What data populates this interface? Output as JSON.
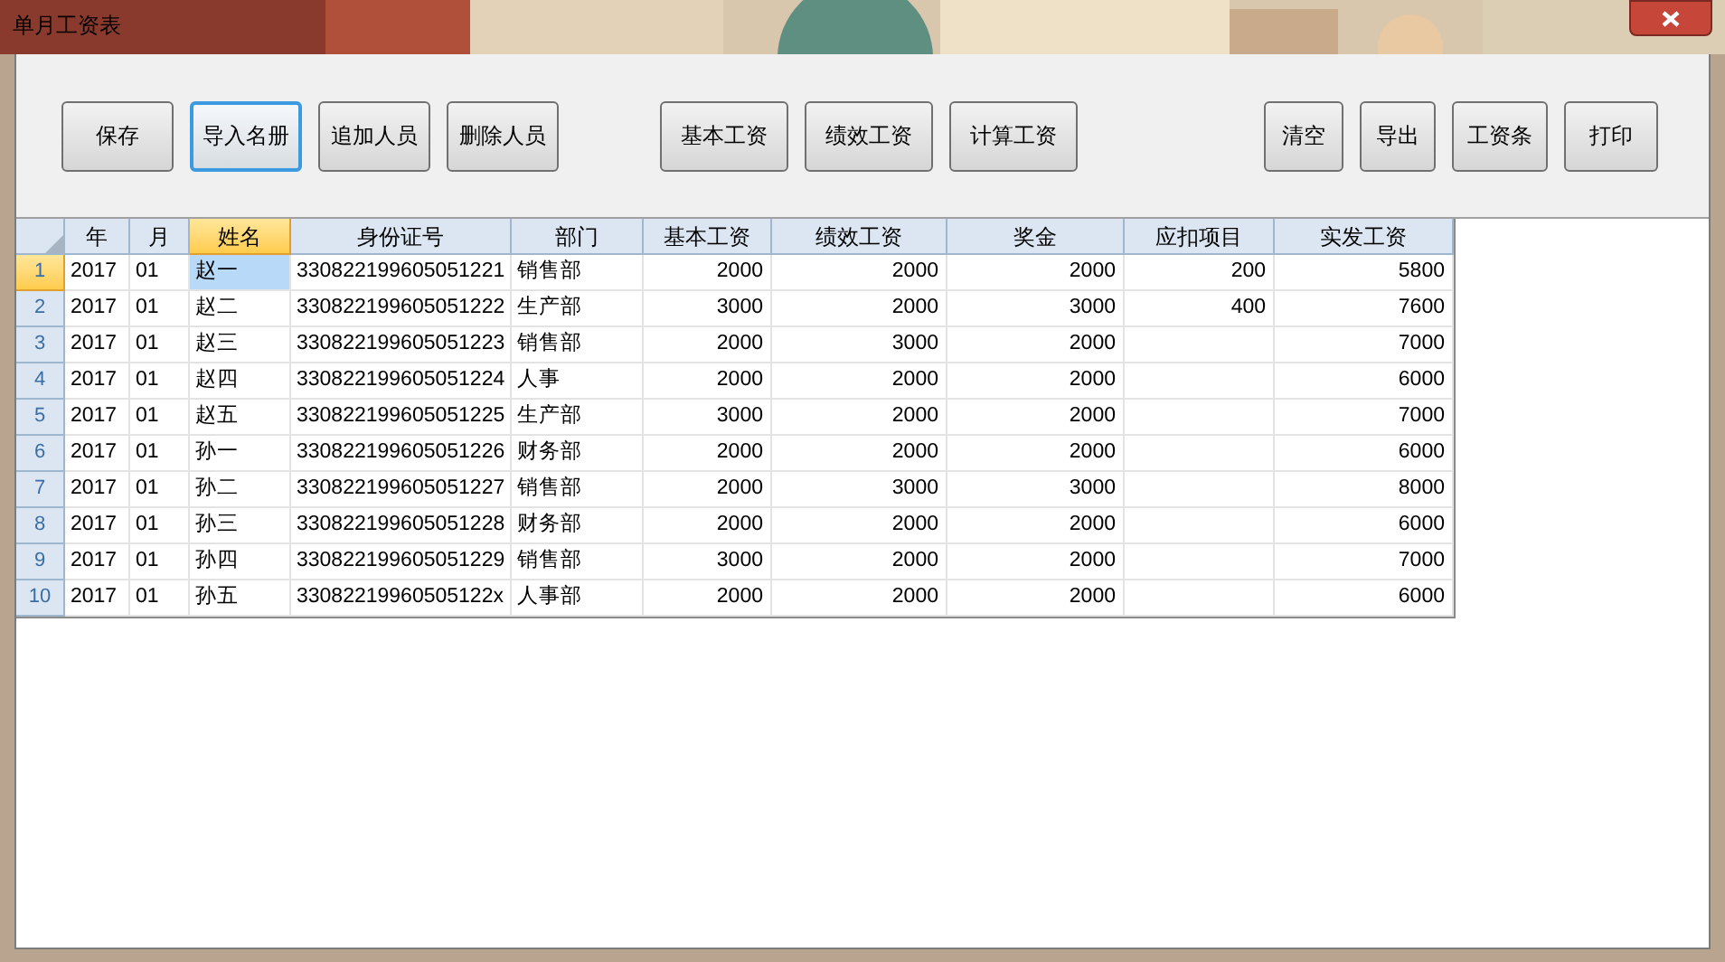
{
  "window": {
    "title": "单月工资表"
  },
  "toolbar": {
    "groups": [
      [
        {
          "label": "保存",
          "focused": false
        },
        {
          "label": "导入名册",
          "focused": true
        },
        {
          "label": "追加人员",
          "focused": false
        },
        {
          "label": "删除人员",
          "focused": false
        }
      ],
      [
        {
          "label": "基本工资",
          "focused": false
        },
        {
          "label": "绩效工资",
          "focused": false
        },
        {
          "label": "计算工资",
          "focused": false
        }
      ],
      [
        {
          "label": "清空",
          "focused": false
        },
        {
          "label": "导出",
          "focused": false
        },
        {
          "label": "工资条",
          "focused": false
        },
        {
          "label": "打印",
          "focused": false
        }
      ]
    ]
  },
  "table": {
    "columns": [
      {
        "label": "年",
        "kind": "text",
        "selected": false
      },
      {
        "label": "月",
        "kind": "text",
        "selected": false
      },
      {
        "label": "姓名",
        "kind": "text",
        "selected": true
      },
      {
        "label": "身份证号",
        "kind": "text",
        "selected": false
      },
      {
        "label": "部门",
        "kind": "text",
        "selected": false
      },
      {
        "label": "基本工资",
        "kind": "number",
        "selected": false
      },
      {
        "label": "绩效工资",
        "kind": "number",
        "selected": false
      },
      {
        "label": "奖金",
        "kind": "number",
        "selected": false
      },
      {
        "label": "应扣项目",
        "kind": "number",
        "selected": false
      },
      {
        "label": "实发工资",
        "kind": "number",
        "selected": false
      }
    ],
    "rows": [
      {
        "number": "1",
        "selected": true,
        "cells": [
          "2017",
          "01",
          "赵一",
          "330822199605051221",
          "销售部",
          "2000",
          "2000",
          "2000",
          "200",
          "5800"
        ]
      },
      {
        "number": "2",
        "selected": false,
        "cells": [
          "2017",
          "01",
          "赵二",
          "330822199605051222",
          "生产部",
          "3000",
          "2000",
          "3000",
          "400",
          "7600"
        ]
      },
      {
        "number": "3",
        "selected": false,
        "cells": [
          "2017",
          "01",
          "赵三",
          "330822199605051223",
          "销售部",
          "2000",
          "3000",
          "2000",
          "",
          "7000"
        ]
      },
      {
        "number": "4",
        "selected": false,
        "cells": [
          "2017",
          "01",
          "赵四",
          "330822199605051224",
          "人事",
          "2000",
          "2000",
          "2000",
          "",
          "6000"
        ]
      },
      {
        "number": "5",
        "selected": false,
        "cells": [
          "2017",
          "01",
          "赵五",
          "330822199605051225",
          "生产部",
          "3000",
          "2000",
          "2000",
          "",
          "7000"
        ]
      },
      {
        "number": "6",
        "selected": false,
        "cells": [
          "2017",
          "01",
          "孙一",
          "330822199605051226",
          "财务部",
          "2000",
          "2000",
          "2000",
          "",
          "6000"
        ]
      },
      {
        "number": "7",
        "selected": false,
        "cells": [
          "2017",
          "01",
          "孙二",
          "330822199605051227",
          "销售部",
          "2000",
          "3000",
          "3000",
          "",
          "8000"
        ]
      },
      {
        "number": "8",
        "selected": false,
        "cells": [
          "2017",
          "01",
          "孙三",
          "330822199605051228",
          "财务部",
          "2000",
          "2000",
          "2000",
          "",
          "6000"
        ]
      },
      {
        "number": "9",
        "selected": false,
        "cells": [
          "2017",
          "01",
          "孙四",
          "330822199605051229",
          "销售部",
          "3000",
          "2000",
          "2000",
          "",
          "7000"
        ]
      },
      {
        "number": "10",
        "selected": false,
        "cells": [
          "2017",
          "01",
          "孙五",
          "33082219960505122x",
          "人事部",
          "2000",
          "2000",
          "2000",
          "",
          "6000"
        ]
      }
    ]
  }
}
